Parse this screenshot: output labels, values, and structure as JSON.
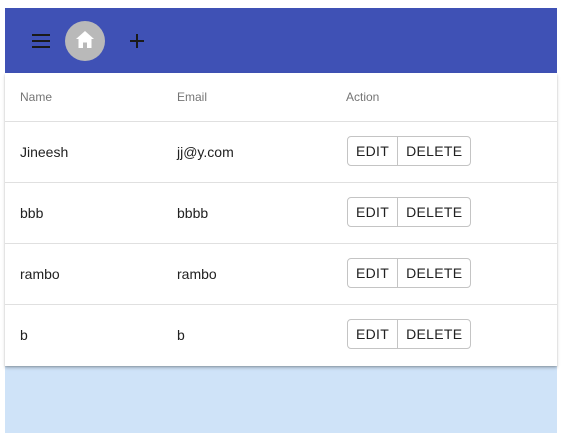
{
  "colors": {
    "toolbar": "#3f51b5",
    "home_button": "#b9b9b9",
    "page_background": "#cfe3f8"
  },
  "toolbar": {
    "menu_icon": "menu-icon",
    "home_icon": "home-icon",
    "add_icon": "plus-icon"
  },
  "table": {
    "headers": {
      "name": "Name",
      "email": "Email",
      "action": "Action"
    },
    "edit_label": "EDIT",
    "delete_label": "DELETE",
    "rows": [
      {
        "name": "Jineesh",
        "email": "jj@y.com"
      },
      {
        "name": "bbb",
        "email": "bbbb"
      },
      {
        "name": "rambo",
        "email": "rambo"
      },
      {
        "name": "b",
        "email": "b"
      }
    ]
  }
}
